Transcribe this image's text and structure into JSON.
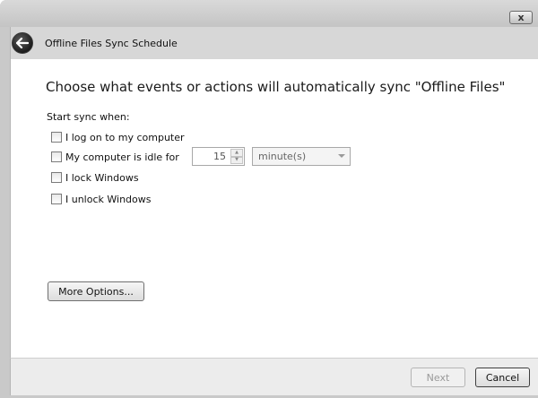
{
  "window": {
    "close_label": "x"
  },
  "nav": {
    "title": "Offline Files Sync Schedule"
  },
  "main": {
    "heading": "Choose what events or actions will automatically sync \"Offline Files\"",
    "start_label": "Start sync when:",
    "options": [
      {
        "label": "I log on to my computer",
        "checked": false
      },
      {
        "label": "My computer is idle for",
        "checked": false
      },
      {
        "label": "I lock Windows",
        "checked": false
      },
      {
        "label": "I unlock Windows",
        "checked": false
      }
    ],
    "idle_value": "15",
    "idle_unit": "minute(s)",
    "more_options_label": "More Options..."
  },
  "footer": {
    "next_label": "Next",
    "cancel_label": "Cancel"
  }
}
